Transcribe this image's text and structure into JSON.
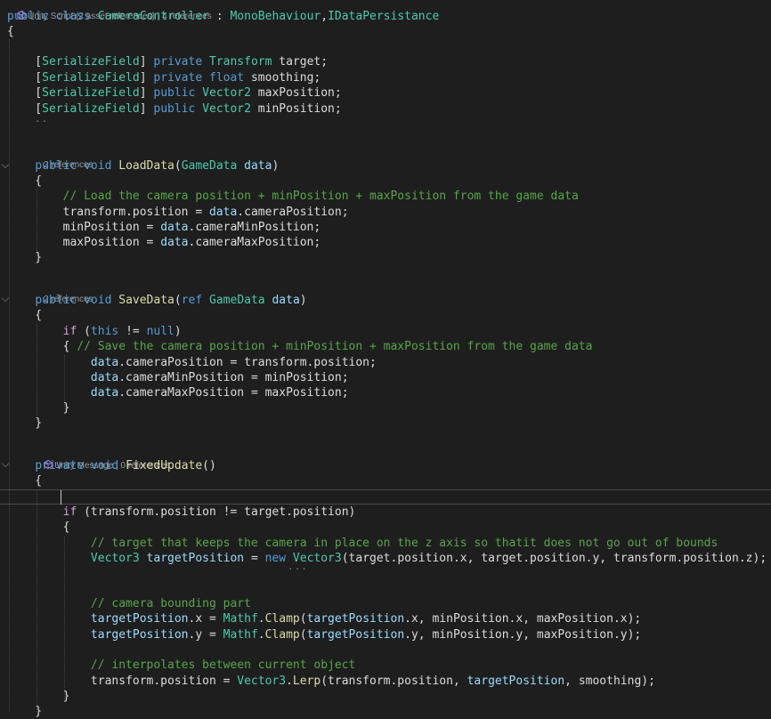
{
  "code_lens": {
    "class_header": "Unity Script (2 asset references) | 4 references",
    "load_data": "2 references",
    "save_data": "2 references",
    "fixed_update": "Unity Message | 0 references"
  },
  "code_lines": [
    [
      [
        "kw",
        "public"
      ],
      [
        "pl",
        " "
      ],
      [
        "kw",
        "class"
      ],
      [
        "pl",
        " "
      ],
      [
        "ty",
        "CameraController"
      ],
      [
        "pl",
        " : "
      ],
      [
        "ty",
        "MonoBehaviour"
      ],
      [
        "pl",
        ","
      ],
      [
        "ty",
        "IDataPersistance"
      ]
    ],
    [
      [
        "pl",
        "{"
      ]
    ],
    [],
    [
      [
        "pl",
        "    ["
      ],
      [
        "ty",
        "SerializeField"
      ],
      [
        "pl",
        "] "
      ],
      [
        "kw",
        "private"
      ],
      [
        "pl",
        " "
      ],
      [
        "ty",
        "Transform"
      ],
      [
        "pl",
        " target;"
      ]
    ],
    [
      [
        "pl",
        "    ["
      ],
      [
        "ty",
        "SerializeField"
      ],
      [
        "pl",
        "] "
      ],
      [
        "kw",
        "private"
      ],
      [
        "pl",
        " "
      ],
      [
        "kw",
        "float"
      ],
      [
        "pl",
        " smoothing;"
      ]
    ],
    [
      [
        "pl",
        "    ["
      ],
      [
        "ty",
        "SerializeField"
      ],
      [
        "pl",
        "] "
      ],
      [
        "kw",
        "public"
      ],
      [
        "pl",
        " "
      ],
      [
        "ty",
        "Vector2"
      ],
      [
        "pl",
        " maxPosition;"
      ]
    ],
    [
      [
        "pl",
        "    ["
      ],
      [
        "ty",
        "SerializeField"
      ],
      [
        "pl",
        "] "
      ],
      [
        "kw",
        "public"
      ],
      [
        "pl",
        " "
      ],
      [
        "ty",
        "Vector2"
      ],
      [
        "pl",
        " minPosition;"
      ]
    ],
    [],
    [],
    [
      [
        "pl",
        "    "
      ],
      [
        "kw",
        "public"
      ],
      [
        "pl",
        " "
      ],
      [
        "kw",
        "void"
      ],
      [
        "pl",
        " "
      ],
      [
        "fn",
        "LoadData"
      ],
      [
        "pl",
        "("
      ],
      [
        "ty",
        "GameData"
      ],
      [
        "pl",
        " "
      ],
      [
        "va",
        "data"
      ],
      [
        "pl",
        ")"
      ]
    ],
    [
      [
        "pl",
        "    {"
      ]
    ],
    [
      [
        "pl",
        "        "
      ],
      [
        "cm",
        "// Load the camera position + minPosition + maxPosition from the game data"
      ]
    ],
    [
      [
        "pl",
        "        transform."
      ],
      [
        "pl",
        "position = "
      ],
      [
        "va",
        "data"
      ],
      [
        "pl",
        ".cameraPosition;"
      ]
    ],
    [
      [
        "pl",
        "        minPosition = "
      ],
      [
        "va",
        "data"
      ],
      [
        "pl",
        ".cameraMinPosition;"
      ]
    ],
    [
      [
        "pl",
        "        maxPosition = "
      ],
      [
        "va",
        "data"
      ],
      [
        "pl",
        ".cameraMaxPosition;"
      ]
    ],
    [
      [
        "pl",
        "    }"
      ]
    ],
    [],
    [
      [
        "pl",
        "    "
      ],
      [
        "kw",
        "public"
      ],
      [
        "pl",
        " "
      ],
      [
        "kw",
        "void"
      ],
      [
        "pl",
        " "
      ],
      [
        "fn",
        "SaveData"
      ],
      [
        "pl",
        "("
      ],
      [
        "kw",
        "ref"
      ],
      [
        "pl",
        " "
      ],
      [
        "ty",
        "GameData"
      ],
      [
        "pl",
        " "
      ],
      [
        "va",
        "data"
      ],
      [
        "pl",
        ")"
      ]
    ],
    [
      [
        "pl",
        "    {"
      ]
    ],
    [
      [
        "pl",
        "        "
      ],
      [
        "kc",
        "if"
      ],
      [
        "pl",
        " ("
      ],
      [
        "kw",
        "this"
      ],
      [
        "pl",
        " != "
      ],
      [
        "kw",
        "null"
      ],
      [
        "pl",
        ")"
      ]
    ],
    [
      [
        "pl",
        "        { "
      ],
      [
        "cm",
        "// Save the camera position + minPosition + maxPosition from the game data"
      ]
    ],
    [
      [
        "pl",
        "            "
      ],
      [
        "va",
        "data"
      ],
      [
        "pl",
        ".cameraPosition = transform.position;"
      ]
    ],
    [
      [
        "pl",
        "            "
      ],
      [
        "va",
        "data"
      ],
      [
        "pl",
        ".cameraMinPosition = minPosition;"
      ]
    ],
    [
      [
        "pl",
        "            "
      ],
      [
        "va",
        "data"
      ],
      [
        "pl",
        ".cameraMaxPosition = maxPosition;"
      ]
    ],
    [
      [
        "pl",
        "        }"
      ]
    ],
    [
      [
        "pl",
        "    }"
      ]
    ],
    [],
    [
      [
        "pl",
        "    "
      ],
      [
        "kw",
        "private"
      ],
      [
        "pl",
        " "
      ],
      [
        "kw",
        "void"
      ],
      [
        "pl",
        " "
      ],
      [
        "fn",
        "FixedUpdate"
      ],
      [
        "pl",
        "()"
      ]
    ],
    [
      [
        "pl",
        "    {"
      ]
    ],
    [],
    [
      [
        "pl",
        "        "
      ],
      [
        "kc",
        "if"
      ],
      [
        "pl",
        " (transform.position != target.position)"
      ]
    ],
    [
      [
        "pl",
        "        {"
      ]
    ],
    [
      [
        "pl",
        "            "
      ],
      [
        "cm",
        "// target that keeps the camera in place on the z axis so thatit does not go out of bounds"
      ]
    ],
    [
      [
        "pl",
        "            "
      ],
      [
        "ty",
        "Vector3"
      ],
      [
        "pl",
        " "
      ],
      [
        "va",
        "targetPosition"
      ],
      [
        "pl",
        " = "
      ],
      [
        "kw",
        "new"
      ],
      [
        "pl",
        " "
      ],
      [
        "ty",
        "Vector3"
      ],
      [
        "pl",
        "(target.position.x, target.position.y, transform.position.z);"
      ]
    ],
    [],
    [],
    [
      [
        "pl",
        "            "
      ],
      [
        "cm",
        "// camera bounding part"
      ]
    ],
    [
      [
        "pl",
        "            "
      ],
      [
        "va",
        "targetPosition"
      ],
      [
        "pl",
        ".x = "
      ],
      [
        "ty",
        "Mathf"
      ],
      [
        "pl",
        "."
      ],
      [
        "fn",
        "Clamp"
      ],
      [
        "pl",
        "("
      ],
      [
        "va",
        "targetPosition"
      ],
      [
        "pl",
        ".x, minPosition.x, maxPosition.x);"
      ]
    ],
    [
      [
        "pl",
        "            "
      ],
      [
        "va",
        "targetPosition"
      ],
      [
        "pl",
        ".y = "
      ],
      [
        "ty",
        "Mathf"
      ],
      [
        "pl",
        "."
      ],
      [
        "fn",
        "Clamp"
      ],
      [
        "pl",
        "("
      ],
      [
        "va",
        "targetPosition"
      ],
      [
        "pl",
        ".y, minPosition.y, maxPosition.y);"
      ]
    ],
    [],
    [
      [
        "pl",
        "            "
      ],
      [
        "cm",
        "// interpolates between current object"
      ]
    ],
    [
      [
        "pl",
        "            transform.position = "
      ],
      [
        "ty",
        "Vector3"
      ],
      [
        "pl",
        "."
      ],
      [
        "fn",
        "Lerp"
      ],
      [
        "pl",
        "(transform.position, "
      ],
      [
        "va",
        "targetPosition"
      ],
      [
        "pl",
        ", smoothing);"
      ]
    ],
    [
      [
        "pl",
        "        }"
      ]
    ],
    [
      [
        "pl",
        "    }"
      ]
    ]
  ],
  "colors": {
    "background": "#1e1e1e",
    "keyword": "#569cd6",
    "control_keyword": "#d8a0df",
    "type": "#4ec9b0",
    "method": "#dcdcaa",
    "variable": "#9cdcfe",
    "comment": "#57a64a",
    "plain": "#dcdcdc",
    "code_lens": "#999999"
  },
  "icons": {
    "code_lens_unity": "unity-cube-icon"
  }
}
